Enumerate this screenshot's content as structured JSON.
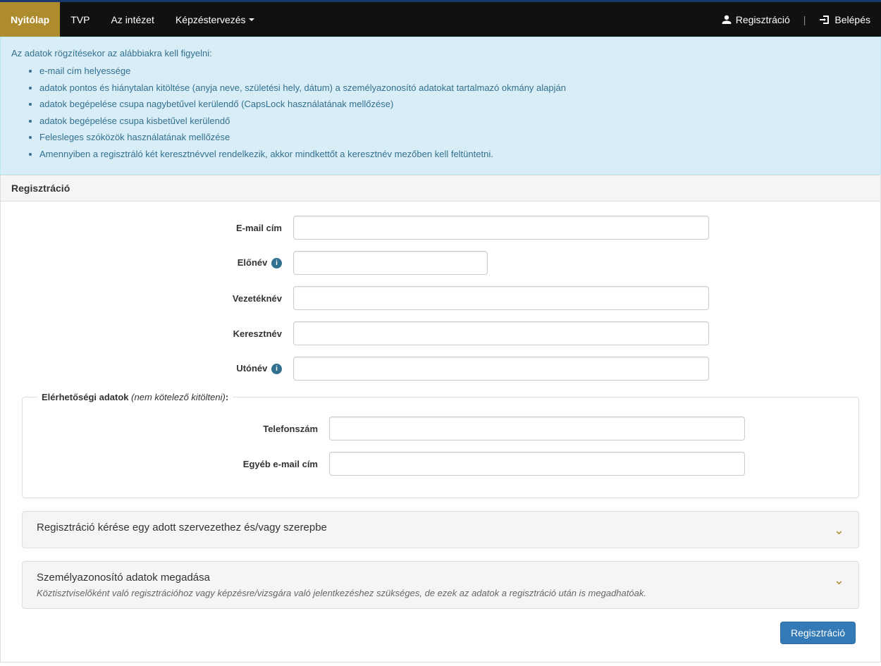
{
  "navbar": {
    "items": [
      {
        "label": "Nyitólap",
        "active": true
      },
      {
        "label": "TVP",
        "active": false
      },
      {
        "label": "Az intézet",
        "active": false
      },
      {
        "label": "Képzéstervezés",
        "active": false,
        "dropdown": true
      }
    ],
    "register_label": "Regisztráció",
    "login_label": "Belépés"
  },
  "alert": {
    "intro": "Az adatok rögzítésekor az alábbiakra kell figyelni:",
    "items": [
      "e-mail cím helyessége",
      "adatok pontos és hiánytalan kitöltése (anyja neve, születési hely, dátum) a személyazonosító adatokat tartalmazó okmány alapján",
      "adatok begépelése csupa nagybetűvel kerülendő (CapsLock használatának mellőzése)",
      "adatok begépelése csupa kisbetűvel kerülendő",
      "Felesleges szóközök használatának mellőzése",
      "Amennyiben a regisztráló két keresztnévvel rendelkezik, akkor mindkettőt a keresztnév mezőben kell feltüntetni."
    ]
  },
  "panel_title": "Regisztráció",
  "form": {
    "email_label": "E-mail cím",
    "prefix_label": "Előnév",
    "lastname_label": "Vezetéknév",
    "firstname_label": "Keresztnév",
    "middlename_label": "Utónév"
  },
  "contact_group": {
    "legend_bold": "Elérhetőségi adatok",
    "legend_italic": "(nem kötelező kitölteni)",
    "phone_label": "Telefonszám",
    "other_email_label": "Egyéb e-mail cím"
  },
  "collapse1": {
    "title": "Regisztráció kérése egy adott szervezethez és/vagy szerepbe"
  },
  "collapse2": {
    "title": "Személyazonosító adatok megadása",
    "sub": "Köztisztviselőként való regisztrációhoz vagy képzésre/vizsgára való jelentkezéshez szükséges, de ezek az adatok a regisztráció után is megadhatóak."
  },
  "submit_label": "Regisztráció"
}
